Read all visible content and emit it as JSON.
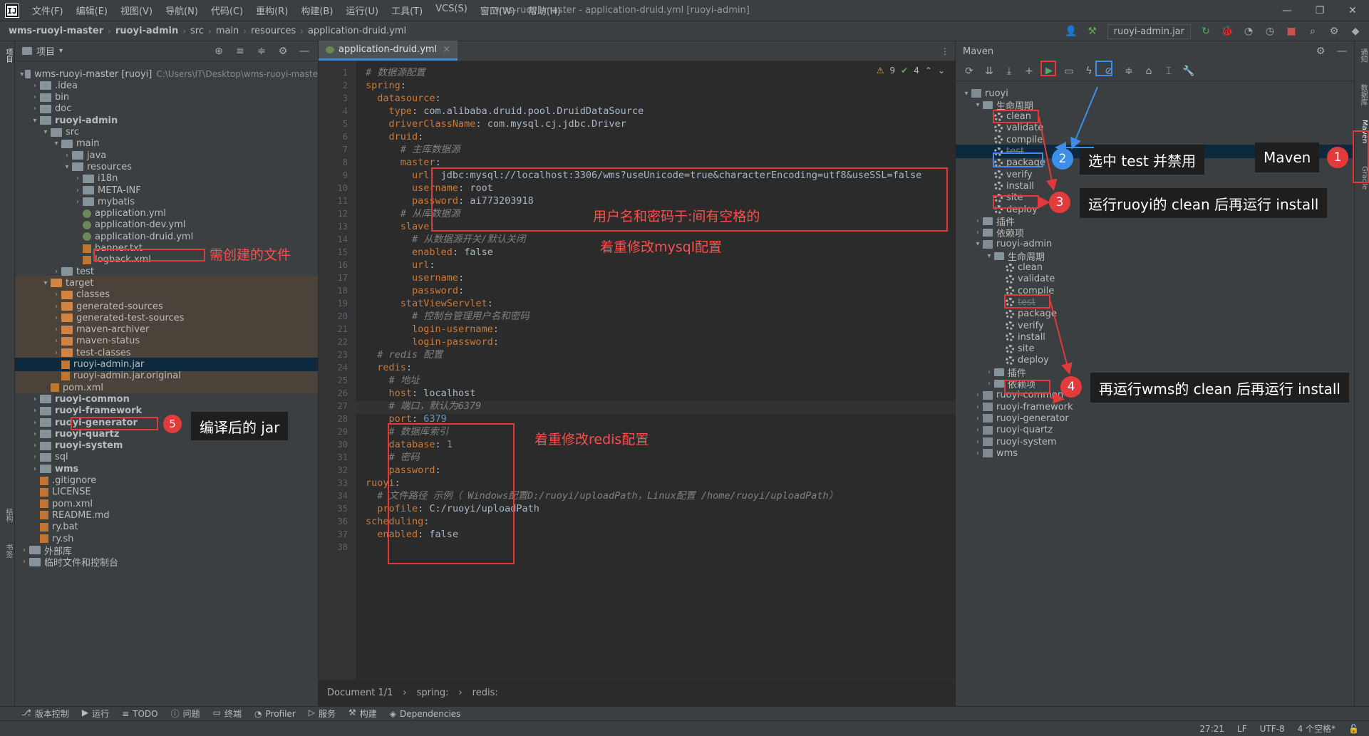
{
  "menu": {
    "items": [
      "文件(F)",
      "编辑(E)",
      "视图(V)",
      "导航(N)",
      "代码(C)",
      "重构(R)",
      "构建(B)",
      "运行(U)",
      "工具(T)",
      "VCS(S)",
      "窗口(W)",
      "帮助(H)"
    ],
    "window_title": "wms-ruoyi-master - application-druid.yml [ruoyi-admin]"
  },
  "nav": {
    "crumbs": [
      "wms-ruoyi-master",
      "ruoyi-admin",
      "src",
      "main",
      "resources",
      "application-druid.yml"
    ],
    "run_config": "ruoyi-admin.jar"
  },
  "project": {
    "title": "项目",
    "rows": [
      {
        "t": "wms-ruoyi-master [ruoyi]",
        "g": "C:\\Users\\IT\\Desktop\\wms-ruoyi-maste",
        "ind": 0,
        "ar": "v",
        "ic": "fold",
        "b": false
      },
      {
        "t": ".idea",
        "ind": 1,
        "ar": ">",
        "ic": "fold"
      },
      {
        "t": "bin",
        "ind": 1,
        "ar": ">",
        "ic": "fold"
      },
      {
        "t": "doc",
        "ind": 1,
        "ar": ">",
        "ic": "fold"
      },
      {
        "t": "ruoyi-admin",
        "ind": 1,
        "ar": "v",
        "ic": "fold",
        "b": true
      },
      {
        "t": "src",
        "ind": 2,
        "ar": "v",
        "ic": "fold"
      },
      {
        "t": "main",
        "ind": 3,
        "ar": "v",
        "ic": "fold"
      },
      {
        "t": "java",
        "ind": 4,
        "ar": ">",
        "ic": "fold"
      },
      {
        "t": "resources",
        "ind": 4,
        "ar": "v",
        "ic": "fold"
      },
      {
        "t": "i18n",
        "ind": 5,
        "ar": ">",
        "ic": "fold"
      },
      {
        "t": "META-INF",
        "ind": 5,
        "ar": ">",
        "ic": "fold"
      },
      {
        "t": "mybatis",
        "ind": 5,
        "ar": ">",
        "ic": "fold"
      },
      {
        "t": "application.yml",
        "ind": 5,
        "ar": "",
        "ic": "file"
      },
      {
        "t": "application-dev.yml",
        "ind": 5,
        "ar": "",
        "ic": "file"
      },
      {
        "t": "application-druid.yml",
        "ind": 5,
        "ar": "",
        "ic": "file"
      },
      {
        "t": "banner.txt",
        "ind": 5,
        "ar": "",
        "ic": "filex"
      },
      {
        "t": "logback.xml",
        "ind": 5,
        "ar": "",
        "ic": "filex"
      },
      {
        "t": "test",
        "ind": 3,
        "ar": ">",
        "ic": "fold"
      },
      {
        "t": "target",
        "ind": 2,
        "ar": "v",
        "ic": "fold o"
      },
      {
        "t": "classes",
        "ind": 3,
        "ar": ">",
        "ic": "fold o"
      },
      {
        "t": "generated-sources",
        "ind": 3,
        "ar": ">",
        "ic": "fold o"
      },
      {
        "t": "generated-test-sources",
        "ind": 3,
        "ar": ">",
        "ic": "fold o"
      },
      {
        "t": "maven-archiver",
        "ind": 3,
        "ar": ">",
        "ic": "fold o"
      },
      {
        "t": "maven-status",
        "ind": 3,
        "ar": ">",
        "ic": "fold o"
      },
      {
        "t": "test-classes",
        "ind": 3,
        "ar": ">",
        "ic": "fold o"
      },
      {
        "t": "ruoyi-admin.jar",
        "ind": 3,
        "ar": "",
        "ic": "filex"
      },
      {
        "t": "ruoyi-admin.jar.original",
        "ind": 3,
        "ar": "",
        "ic": "filex"
      },
      {
        "t": "pom.xml",
        "ind": 2,
        "ar": "",
        "ic": "filex"
      },
      {
        "t": "ruoyi-common",
        "ind": 1,
        "ar": ">",
        "ic": "fold",
        "b": true
      },
      {
        "t": "ruoyi-framework",
        "ind": 1,
        "ar": ">",
        "ic": "fold",
        "b": true
      },
      {
        "t": "ruoyi-generator",
        "ind": 1,
        "ar": ">",
        "ic": "fold",
        "b": true
      },
      {
        "t": "ruoyi-quartz",
        "ind": 1,
        "ar": ">",
        "ic": "fold",
        "b": true
      },
      {
        "t": "ruoyi-system",
        "ind": 1,
        "ar": ">",
        "ic": "fold",
        "b": true
      },
      {
        "t": "sql",
        "ind": 1,
        "ar": ">",
        "ic": "fold"
      },
      {
        "t": "wms",
        "ind": 1,
        "ar": ">",
        "ic": "fold",
        "b": true
      },
      {
        "t": ".gitignore",
        "ind": 1,
        "ar": "",
        "ic": "filex"
      },
      {
        "t": "LICENSE",
        "ind": 1,
        "ar": "",
        "ic": "filex"
      },
      {
        "t": "pom.xml",
        "ind": 1,
        "ar": "",
        "ic": "filex"
      },
      {
        "t": "README.md",
        "ind": 1,
        "ar": "",
        "ic": "filex"
      },
      {
        "t": "ry.bat",
        "ind": 1,
        "ar": "",
        "ic": "filex"
      },
      {
        "t": "ry.sh",
        "ind": 1,
        "ar": "",
        "ic": "filex"
      },
      {
        "t": "外部库",
        "ind": 0,
        "ar": ">",
        "ic": "fold"
      },
      {
        "t": "临时文件和控制台",
        "ind": 0,
        "ar": ">",
        "ic": "fold"
      }
    ]
  },
  "editor": {
    "tab": "application-druid.yml",
    "warnings": "9",
    "ok": "4",
    "lines": [
      [
        [
          "c",
          "# 数据源配置"
        ]
      ],
      [
        [
          "k",
          "spring"
        ],
        [
          "s",
          ":"
        ]
      ],
      [
        [
          "s",
          "  "
        ],
        [
          "k",
          "datasource"
        ],
        [
          "s",
          ":"
        ]
      ],
      [
        [
          "s",
          "    "
        ],
        [
          "k",
          "type"
        ],
        [
          "s",
          ": com.alibaba.druid.pool.DruidDataSource"
        ]
      ],
      [
        [
          "s",
          "    "
        ],
        [
          "k",
          "driverClassName"
        ],
        [
          "s",
          ": com.mysql.cj.jdbc.Driver"
        ]
      ],
      [
        [
          "s",
          "    "
        ],
        [
          "k",
          "druid"
        ],
        [
          "s",
          ":"
        ]
      ],
      [
        [
          "s",
          "      "
        ],
        [
          "c",
          "# 主库数据源"
        ]
      ],
      [
        [
          "s",
          "      "
        ],
        [
          "k",
          "master"
        ],
        [
          "s",
          ":"
        ]
      ],
      [
        [
          "s",
          "        "
        ],
        [
          "k",
          "url"
        ],
        [
          "s",
          ": jdbc:mysql://localhost:3306/wms?useUnicode=true&characterEncoding=utf8&useSSL=false"
        ]
      ],
      [
        [
          "s",
          "        "
        ],
        [
          "k",
          "username"
        ],
        [
          "s",
          ": root"
        ]
      ],
      [
        [
          "s",
          "        "
        ],
        [
          "k",
          "password"
        ],
        [
          "s",
          ": ai773203918"
        ]
      ],
      [
        [
          "s",
          "      "
        ],
        [
          "c",
          "# 从库数据源"
        ]
      ],
      [
        [
          "s",
          "      "
        ],
        [
          "k",
          "slave"
        ],
        [
          "s",
          ":"
        ]
      ],
      [
        [
          "s",
          "        "
        ],
        [
          "c",
          "# 从数据源开关/默认关闭"
        ]
      ],
      [
        [
          "s",
          "        "
        ],
        [
          "k",
          "enabled"
        ],
        [
          "s",
          ": false"
        ]
      ],
      [
        [
          "s",
          "        "
        ],
        [
          "k",
          "url"
        ],
        [
          "s",
          ":"
        ]
      ],
      [
        [
          "s",
          "        "
        ],
        [
          "k",
          "username"
        ],
        [
          "s",
          ":"
        ]
      ],
      [
        [
          "s",
          "        "
        ],
        [
          "k",
          "password"
        ],
        [
          "s",
          ":"
        ]
      ],
      [
        [
          "s",
          "      "
        ],
        [
          "k",
          "statViewServlet"
        ],
        [
          "s",
          ":"
        ]
      ],
      [
        [
          "s",
          "        "
        ],
        [
          "c",
          "# 控制台管理用户名和密码"
        ]
      ],
      [
        [
          "s",
          "        "
        ],
        [
          "k",
          "login-username"
        ],
        [
          "s",
          ":"
        ]
      ],
      [
        [
          "s",
          "        "
        ],
        [
          "k",
          "login-password"
        ],
        [
          "s",
          ":"
        ]
      ],
      [
        [
          "s",
          "  "
        ],
        [
          "c",
          "# redis 配置"
        ]
      ],
      [
        [
          "s",
          "  "
        ],
        [
          "k",
          "redis"
        ],
        [
          "s",
          ":"
        ]
      ],
      [
        [
          "s",
          "    "
        ],
        [
          "c",
          "# 地址"
        ]
      ],
      [
        [
          "s",
          "    "
        ],
        [
          "k",
          "host"
        ],
        [
          "s",
          ": localhost"
        ]
      ],
      [
        [
          "s",
          "    "
        ],
        [
          "c",
          "# 端口，默认为6379"
        ]
      ],
      [
        [
          "s",
          "    "
        ],
        [
          "k",
          "port"
        ],
        [
          "s",
          ": "
        ],
        [
          "n",
          "6379"
        ]
      ],
      [
        [
          "s",
          "    "
        ],
        [
          "c",
          "# 数据库索引"
        ]
      ],
      [
        [
          "s",
          "    "
        ],
        [
          "k",
          "database"
        ],
        [
          "s",
          ": "
        ],
        [
          "n",
          "1"
        ]
      ],
      [
        [
          "s",
          "    "
        ],
        [
          "c",
          "# 密码"
        ]
      ],
      [
        [
          "s",
          "    "
        ],
        [
          "k",
          "password"
        ],
        [
          "s",
          ":"
        ]
      ],
      [
        [
          "k",
          "ruoyi"
        ],
        [
          "s",
          ":"
        ]
      ],
      [
        [
          "s",
          "  "
        ],
        [
          "c",
          "# 文件路径 示例（ Windows配置D:/ruoyi/uploadPath，Linux配置 /home/ruoyi/uploadPath）"
        ]
      ],
      [
        [
          "s",
          "  "
        ],
        [
          "k",
          "profile"
        ],
        [
          "s",
          ": C:/ruoyi/uploadPath"
        ]
      ],
      [
        [
          "k",
          "scheduling"
        ],
        [
          "s",
          ":"
        ]
      ],
      [
        [
          "s",
          "  "
        ],
        [
          "k",
          "enabled"
        ],
        [
          "s",
          ": false"
        ]
      ],
      [
        [
          "s",
          ""
        ]
      ]
    ],
    "footer": [
      "Document 1/1",
      "spring:",
      "redis:"
    ]
  },
  "maven": {
    "title": "Maven",
    "rows": [
      {
        "t": "ruoyi",
        "ind": 0,
        "ar": "v",
        "ic": "mods"
      },
      {
        "t": "生命周期",
        "ind": 1,
        "ar": "v",
        "ic": "fold"
      },
      {
        "t": "clean",
        "ind": 2,
        "ic": "gear"
      },
      {
        "t": "validate",
        "ind": 2,
        "ic": "gear"
      },
      {
        "t": "compile",
        "ind": 2,
        "ic": "gear"
      },
      {
        "t": "test",
        "ind": 2,
        "ic": "gear",
        "dim": true
      },
      {
        "t": "package",
        "ind": 2,
        "ic": "gear"
      },
      {
        "t": "verify",
        "ind": 2,
        "ic": "gear"
      },
      {
        "t": "install",
        "ind": 2,
        "ic": "gear"
      },
      {
        "t": "site",
        "ind": 2,
        "ic": "gear"
      },
      {
        "t": "deploy",
        "ind": 2,
        "ic": "gear"
      },
      {
        "t": "插件",
        "ind": 1,
        "ar": ">",
        "ic": "fold"
      },
      {
        "t": "依赖项",
        "ind": 1,
        "ar": ">",
        "ic": "fold"
      },
      {
        "t": "ruoyi-admin",
        "ind": 1,
        "ar": "v",
        "ic": "mods"
      },
      {
        "t": "生命周期",
        "ind": 2,
        "ar": "v",
        "ic": "fold"
      },
      {
        "t": "clean",
        "ind": 3,
        "ic": "gear"
      },
      {
        "t": "validate",
        "ind": 3,
        "ic": "gear"
      },
      {
        "t": "compile",
        "ind": 3,
        "ic": "gear"
      },
      {
        "t": "test",
        "ind": 3,
        "ic": "gear",
        "dim": true
      },
      {
        "t": "package",
        "ind": 3,
        "ic": "gear"
      },
      {
        "t": "verify",
        "ind": 3,
        "ic": "gear"
      },
      {
        "t": "install",
        "ind": 3,
        "ic": "gear"
      },
      {
        "t": "site",
        "ind": 3,
        "ic": "gear"
      },
      {
        "t": "deploy",
        "ind": 3,
        "ic": "gear"
      },
      {
        "t": "插件",
        "ind": 2,
        "ar": ">",
        "ic": "fold"
      },
      {
        "t": "依赖项",
        "ind": 2,
        "ar": ">",
        "ic": "fold"
      },
      {
        "t": "ruoyi-common",
        "ind": 1,
        "ar": ">",
        "ic": "mods"
      },
      {
        "t": "ruoyi-framework",
        "ind": 1,
        "ar": ">",
        "ic": "mods"
      },
      {
        "t": "ruoyi-generator",
        "ind": 1,
        "ar": ">",
        "ic": "mods"
      },
      {
        "t": "ruoyi-quartz",
        "ind": 1,
        "ar": ">",
        "ic": "mods"
      },
      {
        "t": "ruoyi-system",
        "ind": 1,
        "ar": ">",
        "ic": "mods"
      },
      {
        "t": "wms",
        "ind": 1,
        "ar": ">",
        "ic": "mods"
      }
    ]
  },
  "annotations": {
    "n1": "1",
    "c1": "Maven",
    "n2": "2",
    "c2": "选中 test 并禁用",
    "n3": "3",
    "c3": "运行ruoyi的 clean 后再运行 install",
    "n4": "4",
    "c4": "再运行wms的 clean 后再运行 install",
    "n5": "5",
    "c5": "编译后的 jar",
    "need_file": "需创建的文件",
    "mysql_note": "着重修改mysql配置",
    "user_note": "用户名和密码于:间有空格的",
    "redis_note": "着重修改redis配置"
  },
  "bottom": {
    "tabs": [
      "版本控制",
      "运行",
      "TODO",
      "问题",
      "终端",
      "Profiler",
      "服务",
      "构建",
      "Dependencies"
    ]
  },
  "status": {
    "pos": "27:21",
    "lf": "LF",
    "enc": "UTF-8",
    "indent": "4 个空格*"
  },
  "strips": {
    "left": [
      "项目",
      "结构",
      "书签"
    ],
    "right": [
      "通知",
      "数据库",
      "Maven",
      "Gradle"
    ]
  },
  "colors": {
    "annot_red": "#e03a3a",
    "annot_blue": "#3c8ee8"
  }
}
